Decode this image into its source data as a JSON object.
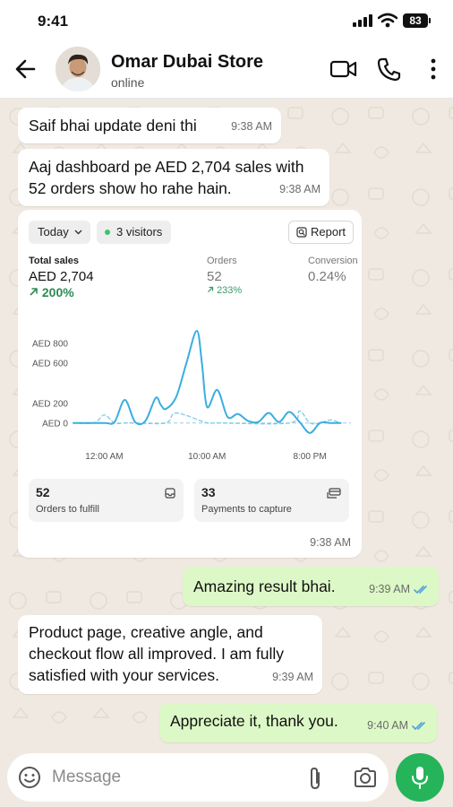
{
  "status_bar": {
    "time": "9:41",
    "battery": "83"
  },
  "header": {
    "contact_name": "Omar Dubai Store",
    "status": "online"
  },
  "messages": [
    {
      "direction": "in",
      "text": "Saif bhai update deni thi",
      "time": "9:38 AM"
    },
    {
      "direction": "in",
      "text_line1": "Aaj dashboard pe AED 2,704 sales with",
      "text_line2": "52 orders show ho rahe hain.",
      "time": "9:38 AM"
    },
    {
      "direction": "in",
      "type": "image",
      "time": "9:38 AM"
    },
    {
      "direction": "out",
      "text": "Amazing result bhai.",
      "time": "9:39 AM"
    },
    {
      "direction": "in",
      "text_line1": "Product page, creative angle, and",
      "text_line2": "checkout flow all improved. I am fully",
      "text_line3": "satisfied with your services.",
      "time": "9:39 AM"
    },
    {
      "direction": "out",
      "text": "Appreciate it, thank you.",
      "time": "9:40 AM"
    }
  ],
  "dashboard": {
    "period": "Today",
    "visitors": "3 visitors",
    "report_label": "Report",
    "metrics": [
      {
        "label": "Total sales",
        "value": "AED 2,704",
        "change": "200%"
      },
      {
        "label": "Orders",
        "value": "52",
        "change": "233%"
      },
      {
        "label": "Conversion",
        "value": "0.24%"
      }
    ],
    "tiles": [
      {
        "count": "52",
        "label": "Orders to fulfill"
      },
      {
        "count": "33",
        "label": "Payments to capture"
      }
    ]
  },
  "chart_data": {
    "type": "line",
    "y_ticks": [
      "AED 800",
      "AED 600",
      "AED 200",
      "AED 0"
    ],
    "y_tick_values": [
      800,
      600,
      200,
      0
    ],
    "x_ticks": [
      "12:00 AM",
      "10:00 AM",
      "8:00 PM"
    ],
    "x_tick_hours": [
      2,
      12,
      22
    ],
    "ylim": [
      -110,
      1000
    ],
    "xlim": [
      -1,
      26
    ],
    "series": [
      {
        "style": "solid",
        "color": "#3aaee0",
        "x": [
          -1,
          2,
          3,
          4,
          5,
          6,
          7,
          7.5,
          8,
          9,
          10,
          11,
          11.5,
          12,
          13,
          14,
          15,
          16,
          17,
          18,
          19,
          20,
          21,
          22,
          23,
          24,
          25
        ],
        "y": [
          0,
          0,
          10,
          230,
          10,
          20,
          250,
          180,
          140,
          260,
          600,
          920,
          600,
          160,
          330,
          60,
          90,
          20,
          10,
          100,
          10,
          110,
          10,
          -100,
          0,
          0,
          0
        ]
      },
      {
        "style": "dashed",
        "color": "#7dcbe8",
        "x": [
          -1,
          1,
          2,
          3,
          4,
          5,
          8,
          9,
          12,
          13,
          20,
          21,
          22,
          23,
          24,
          25
        ],
        "y": [
          0,
          0,
          80,
          0,
          0,
          0,
          0,
          100,
          0,
          0,
          0,
          120,
          0,
          0,
          30,
          0
        ]
      }
    ]
  },
  "composer": {
    "placeholder": "Message"
  },
  "colors": {
    "accent_green": "#25b45a",
    "outgoing_bubble": "#dcf8c6",
    "tick_blue": "#4aa3df",
    "chart_line": "#3aaee0"
  }
}
